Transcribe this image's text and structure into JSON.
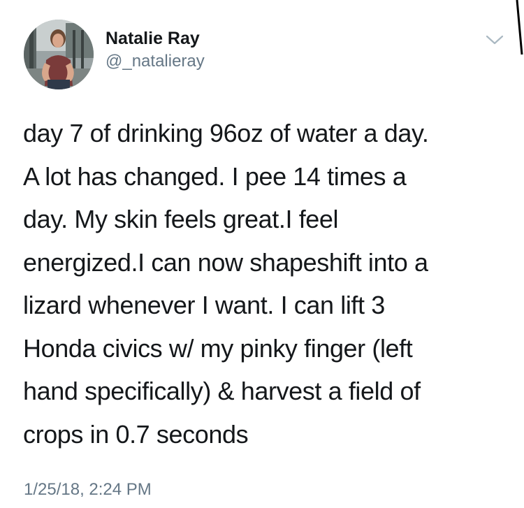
{
  "author": {
    "display_name": "Natalie Ray",
    "handle": "@_natalieray"
  },
  "tweet": {
    "lines": [
      "day 7 of drinking 96oz of water a day.",
      "A lot has changed. I pee 14 times a",
      "day. My skin feels great.I feel",
      "energized.I can now shapeshift into a",
      "lizard whenever I want. I can lift 3",
      "Honda civics w/ my pinky finger (left",
      "hand specifically) & harvest a field of",
      "crops in 0.7 seconds"
    ],
    "timestamp": "1/25/18, 2:24 PM"
  },
  "icons": {
    "menu": "chevron-down-icon"
  },
  "colors": {
    "text": "#14171a",
    "secondary": "#657786",
    "caret": "#aab8c2"
  }
}
